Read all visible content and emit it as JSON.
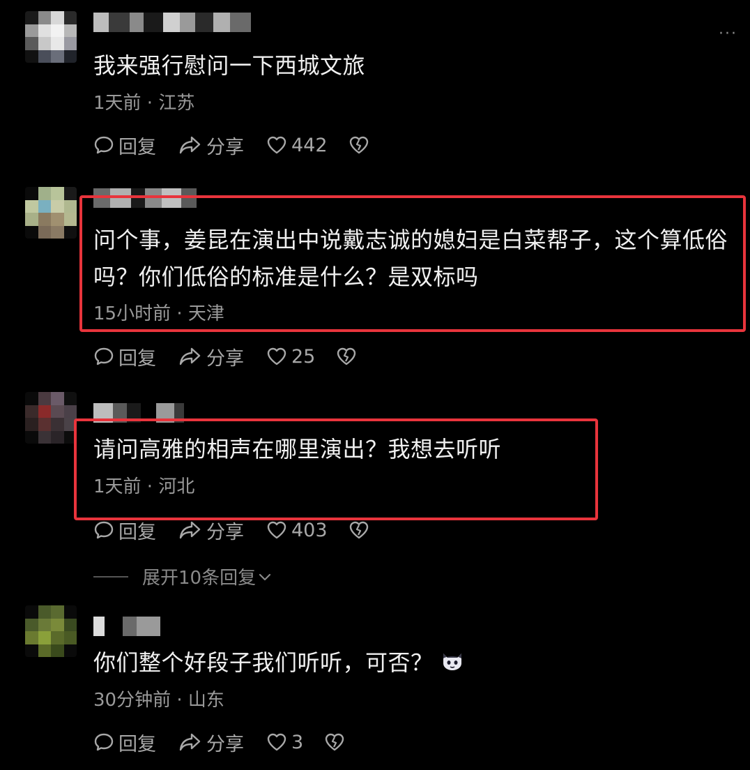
{
  "comments": [
    {
      "text": "我来强行慰问一下西城文旅",
      "meta": "1天前 · 江苏",
      "reply_label": "回复",
      "share_label": "分享",
      "likes": "442"
    },
    {
      "text": "问个事，姜昆在演出中说戴志诚的媳妇是白菜帮子，这个算低俗吗？你们低俗的标准是什么？是双标吗",
      "meta": "15小时前 · 天津",
      "reply_label": "回复",
      "share_label": "分享",
      "likes": "25"
    },
    {
      "text": "请问高雅的相声在哪里演出？我想去听听",
      "meta": "1天前 · 河北",
      "reply_label": "回复",
      "share_label": "分享",
      "likes": "403",
      "expand_label": "展开10条回复"
    },
    {
      "text": "你们整个好段子我们听听，可否？",
      "meta": "30分钟前 · 山东",
      "reply_label": "回复",
      "share_label": "分享",
      "likes": "3"
    }
  ],
  "colors": {
    "background": "#000000",
    "highlight_border": "#e8343c",
    "text": "#f0f0f0",
    "meta": "#9a9a9a"
  },
  "icons": [
    "reply-icon",
    "share-icon",
    "heart-icon",
    "broken-heart-icon",
    "more-icon",
    "chevron-down-icon",
    "cat-emoji-icon"
  ]
}
